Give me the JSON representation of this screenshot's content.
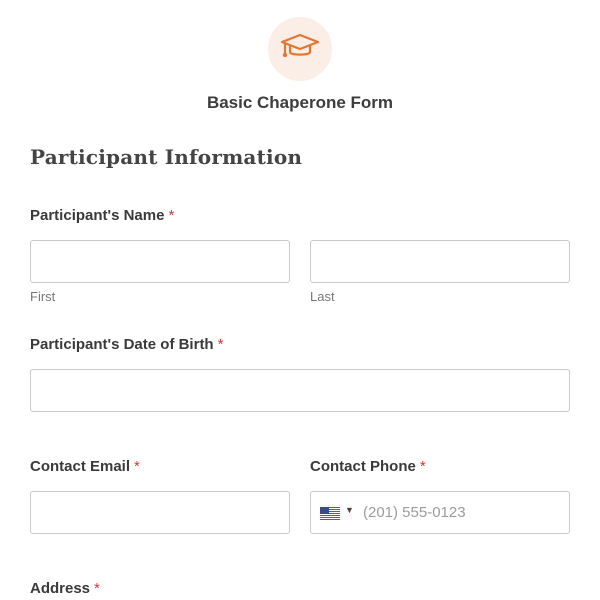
{
  "form": {
    "logo_icon": "graduation-cap-icon",
    "accent_color": "#e27730",
    "title": "Basic Chaperone Form"
  },
  "section": {
    "title": "Participant Information"
  },
  "fields": {
    "name": {
      "label": "Participant's Name",
      "required_mark": "*",
      "first_value": "",
      "last_value": "",
      "first_sublabel": "First",
      "last_sublabel": "Last"
    },
    "dob": {
      "label": "Participant's Date of Birth",
      "required_mark": "*",
      "value": ""
    },
    "email": {
      "label": "Contact Email",
      "required_mark": "*",
      "value": ""
    },
    "phone": {
      "label": "Contact Phone",
      "required_mark": "*",
      "country_icon": "us-flag-icon",
      "placeholder": "(201) 555-0123",
      "value": ""
    },
    "address": {
      "label": "Address",
      "required_mark": "*"
    }
  }
}
